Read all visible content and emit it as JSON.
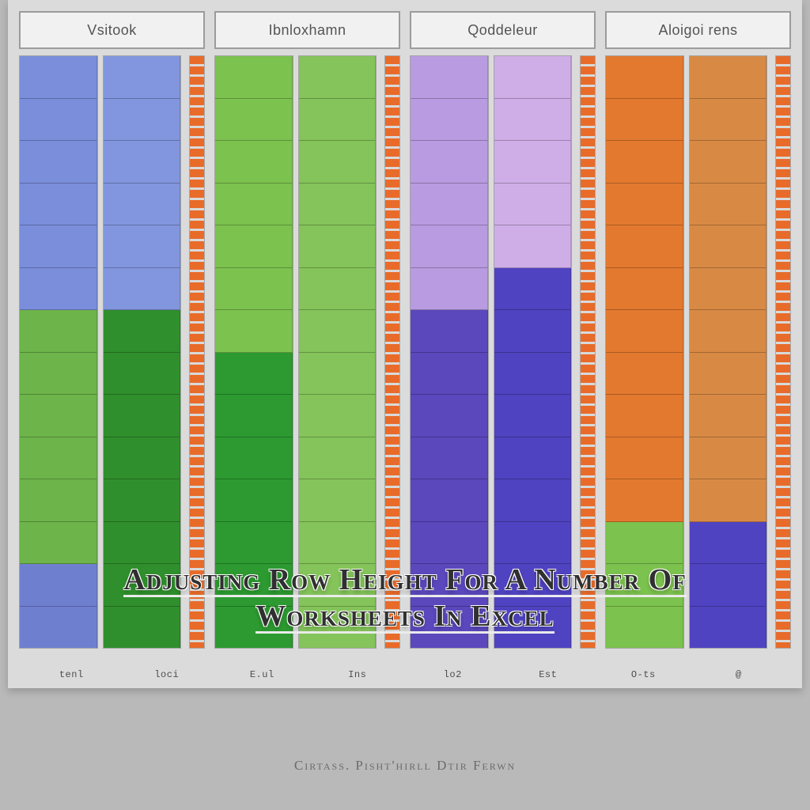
{
  "overlay_title": "Adjusting Row Height For A Number Of Worksheets In Excel",
  "caption": "Cirtass. Pisht'hirll Dtir Ferwn",
  "chart_data": {
    "type": "bar",
    "panels": [
      {
        "header": "Vsitook",
        "rows": 14,
        "columns": [
          {
            "segments": [
              {
                "color": "#7a8edb",
                "span": 6
              },
              {
                "color": "#6db44a",
                "span": 6
              },
              {
                "color": "#6f7fd0",
                "span": 2
              }
            ]
          },
          {
            "segments": [
              {
                "color": "#8296df",
                "span": 6
              },
              {
                "color": "#2f8f2c",
                "span": 8
              }
            ]
          }
        ]
      },
      {
        "header": "Ibnloxhamn",
        "rows": 14,
        "columns": [
          {
            "segments": [
              {
                "color": "#7cc24e",
                "span": 7
              },
              {
                "color": "#2c9a30",
                "span": 7
              }
            ]
          },
          {
            "segments": [
              {
                "color": "#84c45a",
                "span": 14
              }
            ]
          }
        ]
      },
      {
        "header": "Qoddeleur",
        "rows": 14,
        "columns": [
          {
            "segments": [
              {
                "color": "#b89be0",
                "span": 6
              },
              {
                "color": "#5b48bd",
                "span": 8
              }
            ]
          },
          {
            "segments": [
              {
                "color": "#cfaee8",
                "span": 5
              },
              {
                "color": "#5043c1",
                "span": 9
              }
            ]
          }
        ]
      },
      {
        "header": "Aloigoi rens",
        "rows": 14,
        "columns": [
          {
            "segments": [
              {
                "color": "#e3792f",
                "span": 11
              },
              {
                "color": "#7cc24e",
                "span": 3
              }
            ]
          },
          {
            "segments": [
              {
                "color": "#d88a45",
                "span": 11
              },
              {
                "color": "#5043c1",
                "span": 3
              }
            ]
          }
        ]
      }
    ],
    "axis_labels": [
      "tenl",
      "loci",
      "E.ul",
      "Ins",
      "lo2",
      "Est",
      "O-ts",
      "@"
    ]
  }
}
